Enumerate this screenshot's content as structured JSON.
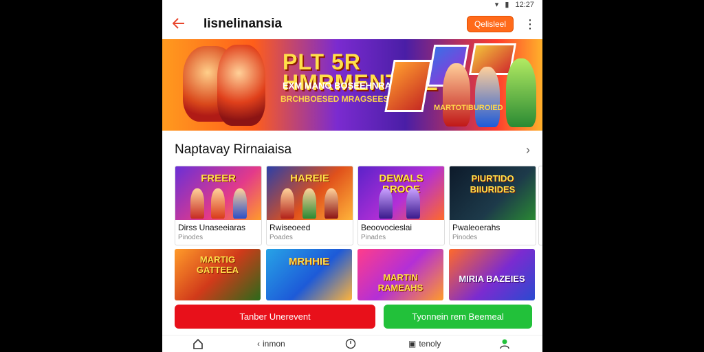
{
  "status": {
    "time": "12:27"
  },
  "appbar": {
    "title": "Iisnelinansia",
    "pill_label": "Qelisleel"
  },
  "banner": {
    "line1": "PLT 5R",
    "line2": "HMRMENTINE",
    "line3": "EXM MANO BOSEEHNRA",
    "line4": "BRCHBOESED MRAGSEES",
    "line5": "MARTOTIBUROIED"
  },
  "section": {
    "title": "Naptavay Rirnaiaisa"
  },
  "games_row1": [
    {
      "thumb_text": "FREER",
      "title": "Dirss Unaseeiaras",
      "sub": "Pinodes"
    },
    {
      "thumb_text": "HAREIE",
      "title": "Rwiseoeed",
      "sub": "Poades"
    },
    {
      "thumb_text": "DEWALS BROOE",
      "title": "Beoovocieslai",
      "sub": "Pinades"
    },
    {
      "thumb_text": "PIURTIDO BIIURIDES",
      "title": "Pwaleoerahs",
      "sub": "Pinodes"
    }
  ],
  "games_row2": [
    {
      "thumb_text": "MARTIG GATTEEA"
    },
    {
      "thumb_text": "MRHHIE"
    },
    {
      "thumb_text": "MARTIN RAMEAHS"
    },
    {
      "thumb_text": "MIRIA BAZEIES"
    }
  ],
  "buttons": {
    "red": "Tanber Unerevent",
    "green": "Tyonnein rem Beemeal"
  },
  "nav": {
    "item2": "inmon",
    "item4": "tenoly"
  },
  "colors": {
    "accent": "#ff6a1a",
    "red": "#e8101a",
    "green": "#22c13a"
  }
}
